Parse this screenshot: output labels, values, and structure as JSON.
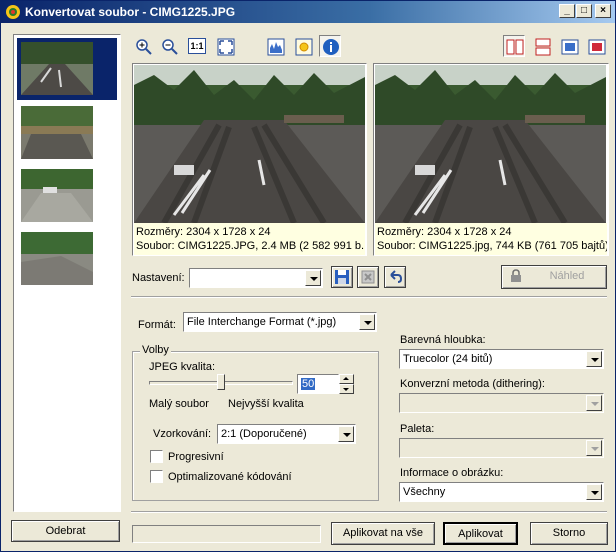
{
  "window": {
    "title": "Konvertovat soubor - CIMG1225.JPG"
  },
  "toolbar": {
    "zoom_actual_label": "1:1"
  },
  "preview_left": {
    "dimensions": "Rozměry: 2304 x 1728 x 24",
    "file": "Soubor: CIMG1225.JPG, 2.4 MB (2 582 991 b..."
  },
  "preview_right": {
    "dimensions": "Rozměry: 2304 x 1728 x 24",
    "file": "Soubor: CIMG1225.jpg, 744 KB (761 705 bajtů)"
  },
  "settings": {
    "label": "Nastavení:",
    "value": "",
    "preview_button": "Náhled"
  },
  "format": {
    "label": "Formát:",
    "value": "File Interchange Format (*.jpg)"
  },
  "options": {
    "group_label": "Volby",
    "jpeg_quality_label": "JPEG kvalita:",
    "jpeg_quality_value": "50",
    "quality_percent": 50,
    "small_file_label": "Malý soubor",
    "best_quality_label": "Nejvyšší kvalita",
    "sampling_label": "Vzorkování:",
    "sampling_value": "2:1 (Doporučené)",
    "progressive_label": "Progresivní",
    "optimized_label": "Optimalizované kódování"
  },
  "right_panel": {
    "color_depth_label": "Barevná hloubka:",
    "color_depth_value": "Truecolor (24 bitů)",
    "dithering_label": "Konverzní metoda (dithering):",
    "dithering_value": "",
    "palette_label": "Paleta:",
    "palette_value": "",
    "image_info_label": "Informace o obrázku:",
    "image_info_value": "Všechny"
  },
  "bottom": {
    "remove_button": "Odebrat",
    "apply_all_button": "Aplikovat na vše",
    "apply_button": "Aplikovat",
    "cancel_button": "Storno"
  }
}
